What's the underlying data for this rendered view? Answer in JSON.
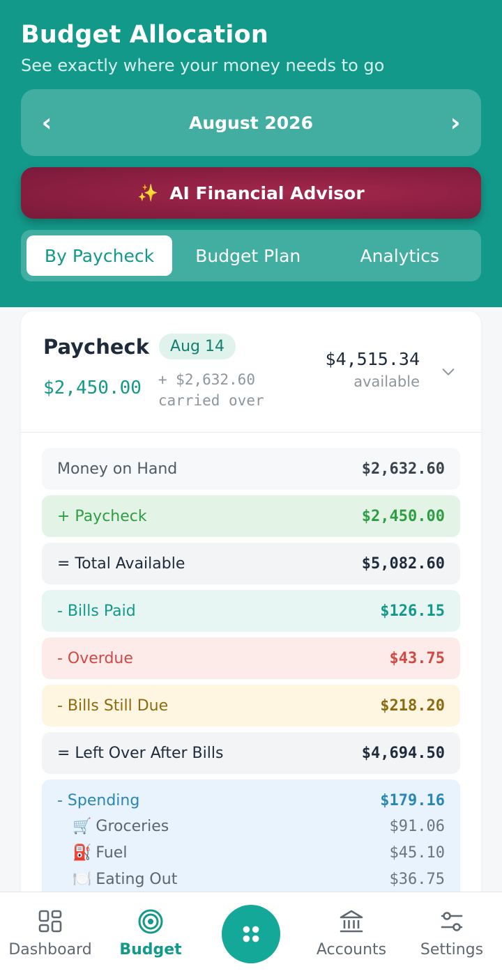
{
  "header": {
    "title": "Budget Allocation",
    "subtitle": "See exactly where your money needs to go"
  },
  "month_selector": {
    "prev_icon": "chevron-left-icon",
    "prev_glyph": "‹",
    "month": "August 2026",
    "next_icon": "chevron-right-icon",
    "next_glyph": "›"
  },
  "advisor": {
    "icon": "sparkles-icon",
    "glyph": "✨",
    "label": "AI Financial Advisor"
  },
  "tabs": [
    {
      "label": "By Paycheck",
      "active": true
    },
    {
      "label": "Budget Plan",
      "active": false
    },
    {
      "label": "Analytics",
      "active": false
    }
  ],
  "paycheck": {
    "title": "Paycheck",
    "date_badge": "Aug 14",
    "amount": "$2,450.00",
    "carried_amount": "+ $2,632.60",
    "carried_label": "carried over",
    "available_amount": "$4,515.34",
    "available_label": "available"
  },
  "summary_rows": [
    {
      "label": "Money on Hand",
      "value": "$2,632.60"
    },
    {
      "label": "+ Paycheck",
      "value": "$2,450.00"
    },
    {
      "label": "= Total Available",
      "value": "$5,082.60"
    },
    {
      "label": "- Bills Paid",
      "value": "$126.15"
    },
    {
      "label": "- Overdue",
      "value": "$43.75"
    },
    {
      "label": "- Bills Still Due",
      "value": "$218.20"
    },
    {
      "label": "= Left Over After Bills",
      "value": "$4,694.50"
    }
  ],
  "spending": {
    "label": "- Spending",
    "value": "$179.16",
    "items": [
      {
        "icon": "🛒",
        "label": "Groceries",
        "value": "$91.06"
      },
      {
        "icon": "⛽",
        "label": "Fuel",
        "value": "$45.10"
      },
      {
        "icon": "🍽️",
        "label": "Eating Out",
        "value": "$36.75"
      }
    ]
  },
  "nav": {
    "dashboard": "Dashboard",
    "budget": "Budget",
    "accounts": "Accounts",
    "settings": "Settings"
  },
  "colors": {
    "brand": "#13998a",
    "advisor": "#8c1f42"
  }
}
